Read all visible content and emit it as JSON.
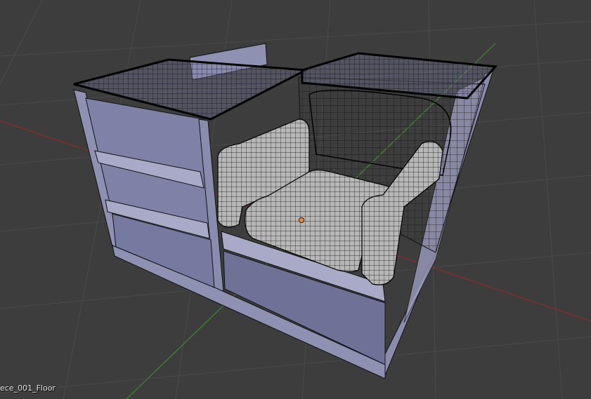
{
  "viewport": {
    "object_name": "ece_001_Floor",
    "background_color": "#3d3d3d",
    "grid_color": "#4a4a4a",
    "x_axis_color": "#8b2a2a",
    "y_axis_color": "#3e8a2e",
    "mesh_fill_color": "#8f91b2",
    "wire_color": "#111111",
    "origin_color": "#f08a3c"
  }
}
